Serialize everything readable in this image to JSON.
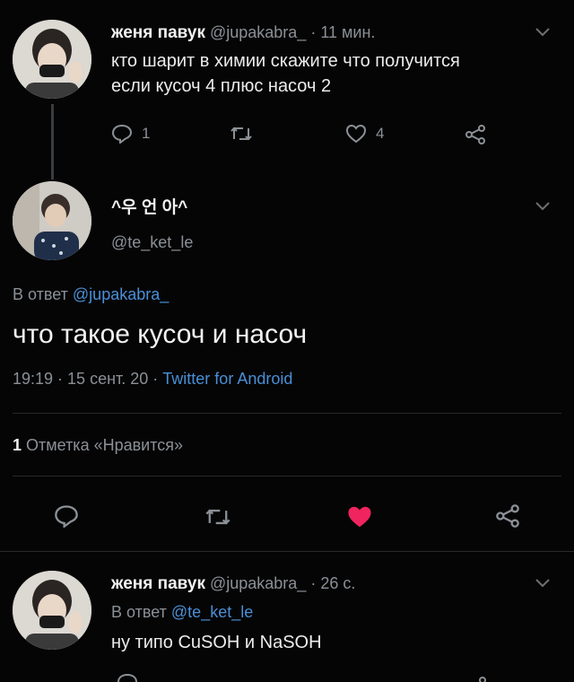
{
  "tweet1": {
    "display_name": "женя павук",
    "handle": "@jupakabra_",
    "time": "· 11 мин.",
    "text_line1": "кто шарит в химии скажите что получится",
    "text_line2": "если кусоч 4 плюс насоч 2",
    "reply_count": "1",
    "like_count": "4"
  },
  "main": {
    "display_name": "^우 언 아^",
    "handle": "@te_ket_le",
    "reply_prefix": "В ответ",
    "reply_to": "@jupakabra_",
    "text": "что такое кусоч и насоч",
    "timestamp": "19:19 · 15 сент. 20 ·",
    "source": "Twitter for Android",
    "likes_number": "1",
    "likes_label": "Отметка «Нравится»"
  },
  "tweet3": {
    "display_name": "женя павук",
    "handle": "@jupakabra_",
    "time": "· 26 с.",
    "reply_prefix": "В ответ",
    "reply_to": "@te_ket_le",
    "text": "ну типо CuSOH и NaSOH"
  },
  "colors": {
    "background": "#050505",
    "link": "#4a8fd6",
    "liked_heart": "#f0245e",
    "muted": "#8b9096"
  }
}
